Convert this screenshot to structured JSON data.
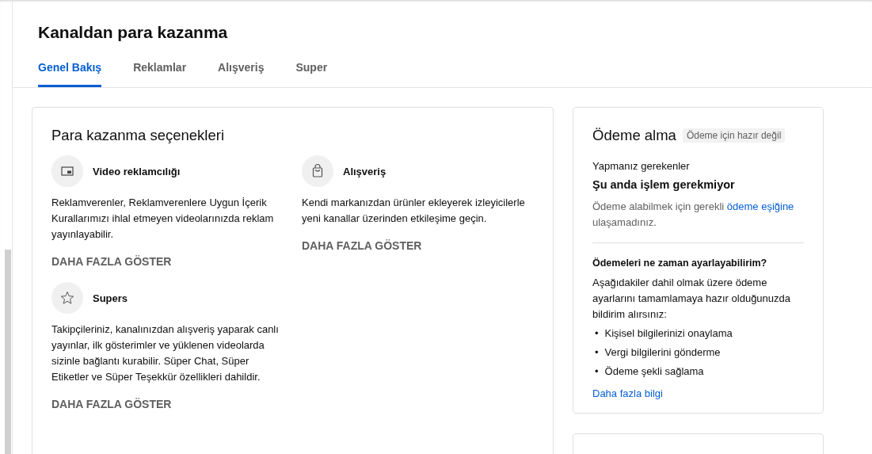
{
  "page_title": "Kanaldan para kazanma",
  "tabs": [
    {
      "label": "Genel Bakış",
      "selected": true
    },
    {
      "label": "Reklamlar",
      "selected": false
    },
    {
      "label": "Alışveriş",
      "selected": false
    },
    {
      "label": "Super",
      "selected": false
    }
  ],
  "options_card": {
    "title": "Para kazanma seçenekleri",
    "options": [
      {
        "title": "Video reklamcılığı",
        "description": "Reklamverenler, Reklamverenlere Uygun İçerik Kurallarımızı ihlal etmeyen videolarınızda reklam yayınlayabilir.",
        "action": "DAHA FAZLA GÖSTER"
      },
      {
        "title": "Alışveriş",
        "description": "Kendi markanızdan ürünler ekleyerek izleyicilerle yeni kanallar üzerinden etkileşime geçin.",
        "action": "DAHA FAZLA GÖSTER"
      },
      {
        "title": "Supers",
        "description": "Takipçileriniz, kanalınızdan alışveriş yaparak canlı yayınlar, ilk gösterimler ve yüklenen videolarda sizinle bağlantı kurabilir. Süper Chat, Süper Etiketler ve Süper Teşekkür özellikleri dahildir.",
        "action": "DAHA FAZLA GÖSTER"
      }
    ]
  },
  "payment_card": {
    "title": "Ödeme alma",
    "status_badge": "Ödeme için hazır değil",
    "todo_label": "Yapmanız gerekenler",
    "todo_value": "Şu anda işlem gerekmiyor",
    "note_before": "Ödeme alabilmek için gerekli ",
    "note_link": "ödeme eşiğine",
    "note_after": " ulaşamadınız.",
    "question": "Ödemeleri ne zaman ayarlayabilirim?",
    "answer": "Aşağıdakiler dahil olmak üzere ödeme ayarlarını tamamlamaya hazır olduğunuzda bildirim alırsınız:",
    "steps": [
      {
        "bullet": "•",
        "text": "Kişisel bilgilerinizi onaylama"
      },
      {
        "bullet": "•",
        "text": "Vergi bilgilerini gönderme"
      },
      {
        "bullet": "•",
        "text": "Ödeme şekli sağlama"
      }
    ],
    "more_link": "Daha fazla bilgi"
  }
}
